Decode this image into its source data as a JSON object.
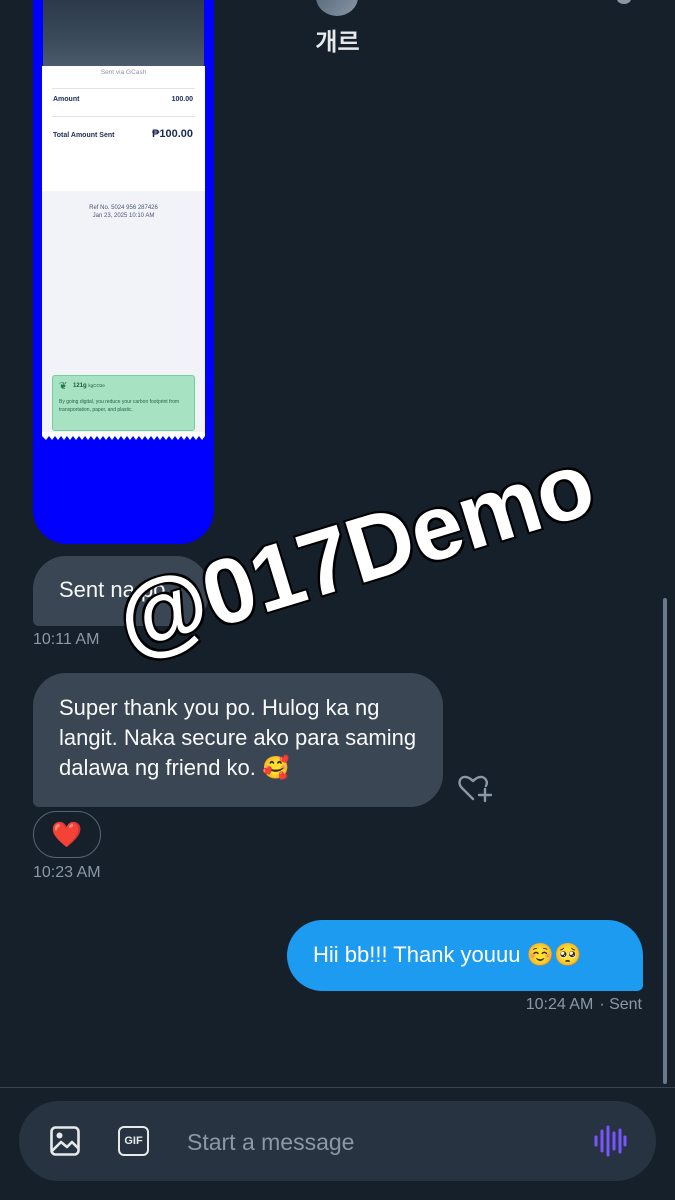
{
  "header": {
    "title": "개르"
  },
  "receipt": {
    "sent_via": "Sent via GCash",
    "amount_label": "Amount",
    "amount_value": "100.00",
    "total_label": "Total Amount Sent",
    "total_value": "₱100.00",
    "ref": "Ref No. 5024 956 287426",
    "date": "Jan 23, 2025 10:10 AM",
    "eco_title": "121g",
    "eco_unit": "kgCO2e",
    "eco_text": "By going digital, you reduce your carbon footprint from transportation, paper, and plastic."
  },
  "messages": {
    "m1_text": "Sent na po.",
    "m1_time": "10:11 AM",
    "m2_text": "Super thank you po. Hulog ka ng langit. Naka secure ako para saming dalawa ng friend ko. 🥰",
    "m2_reaction": "❤️",
    "m2_time": "10:23 AM",
    "m3_text": "Hii bb!!! Thank youuu ☺️🥺",
    "m3_time": "10:24 AM",
    "m3_status": "· Sent"
  },
  "watermark": "@017Demo",
  "composer": {
    "gif_label": "GIF",
    "placeholder": "Start a message"
  },
  "icons": {
    "image": "image-icon",
    "gif": "gif-icon",
    "voice": "voice-wave-icon",
    "add_reaction": "heart-plus-icon"
  },
  "colors": {
    "background": "#15202b",
    "incoming_bubble": "#3a4653",
    "outgoing_bubble": "#1d9bf0",
    "voice_accent": "#7856ff",
    "image_frame": "#0000ff"
  }
}
